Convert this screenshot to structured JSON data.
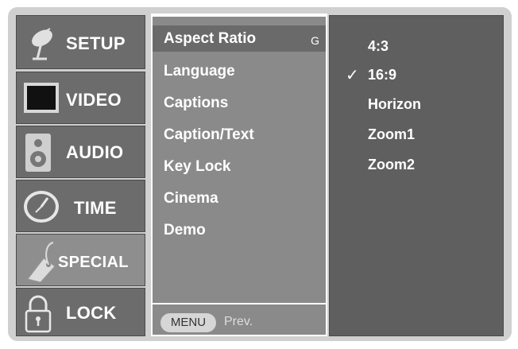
{
  "categories": [
    {
      "label": "SETUP",
      "icon": "satellite-dish-icon"
    },
    {
      "label": "VIDEO",
      "icon": "tv-screen-icon"
    },
    {
      "label": "AUDIO",
      "icon": "speaker-icon"
    },
    {
      "label": "TIME",
      "icon": "clock-icon"
    },
    {
      "label": "SPECIAL",
      "icon": "tag-icon"
    },
    {
      "label": "LOCK",
      "icon": "padlock-icon"
    }
  ],
  "active_category": "SPECIAL",
  "menu": {
    "items": [
      "Aspect Ratio",
      "Language",
      "Captions",
      "Caption/Text",
      "Key Lock",
      "Cinema",
      "Demo"
    ],
    "selected": "Aspect Ratio",
    "arrow_glyph": "G",
    "menu_button": "MENU",
    "prev_label": "Prev."
  },
  "submenu": {
    "options": [
      "4:3",
      "16:9",
      "Horizon",
      "Zoom1",
      "Zoom2"
    ],
    "checked": "16:9",
    "check_glyph": "✓"
  }
}
